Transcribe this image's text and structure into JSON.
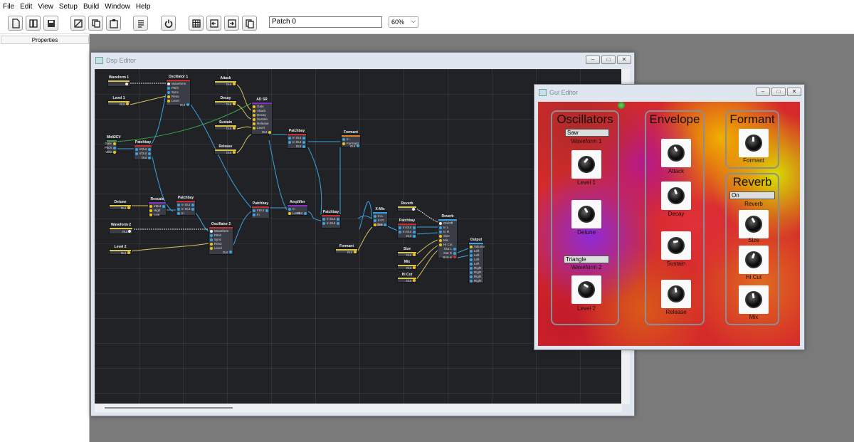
{
  "menu": [
    "File",
    "Edit",
    "View",
    "Setup",
    "Build",
    "Window",
    "Help"
  ],
  "toolbar": {
    "patch_name": "Patch 0",
    "zoom": "60%"
  },
  "properties_title": "Properties",
  "dsp_editor": {
    "title": "Dsp Editor",
    "nodes": {
      "waveform1": "Waveform 1",
      "level1": "Level 1",
      "osc1": "Oscillator 1",
      "midi2cv": "Midi2CV",
      "patchbay1": "Patchbay",
      "attack": "Attack",
      "decay": "Decay",
      "sustain": "Sustain",
      "release": "Release",
      "adsr": "AD SR",
      "patchbay2": "Patchbay",
      "formant1": "Formant",
      "detune": "Detune",
      "rescale": "Rescale",
      "patchbay3": "Patchbay",
      "waveform2": "Waveform 2",
      "level2": "Level 2",
      "osc2": "Oscillator 2",
      "patchbay4": "Patchbay",
      "amplifier": "Amplifier",
      "patchbay5": "Patchbay",
      "xmix": "X-Mix",
      "formant2": "Formant",
      "reverb_ctl": "Reverb",
      "patchbay6": "Patchbay",
      "reverb": "Reverb",
      "output": "Output",
      "size": "Size",
      "mix": "Mix",
      "hicut": "Hi Cut"
    },
    "ports": {
      "out": "Out",
      "in": "In",
      "waveform": "Waveform",
      "pitch": "Pitch",
      "sync": "Sync",
      "reso": "Reso",
      "level": "Level",
      "gate": "Gate",
      "velo": "Velo",
      "attack": "Attack",
      "decay": "Decay",
      "sustain": "Sustain",
      "release": "Release",
      "high": "High",
      "low": "Low",
      "formant": "Formant",
      "in_l": "In L",
      "in_r": "In R",
      "mix": "Mix",
      "onoff": "On/Off",
      "size": "Size",
      "hicut": "Hi Cut",
      "out_l": "Out L",
      "out_r": "Out R",
      "bonus": "Bonus",
      "volume": "Volume",
      "left": "Left",
      "right": "Right"
    }
  },
  "gui_editor": {
    "title": "Gui Editor",
    "oscillators": {
      "title": "Oscillators",
      "wave1_value": "Saw",
      "wave1_label": "Waveform 1",
      "level1": "Level 1",
      "detune": "Detune",
      "wave2_value": "Triangle",
      "wave2_label": "Waveform 2",
      "level2": "Level 2"
    },
    "envelope": {
      "title": "Envelope",
      "attack": "Attack",
      "decay": "Decay",
      "sustain": "Sustain",
      "release": "Release"
    },
    "formant": {
      "title": "Formant",
      "knob": "Formant"
    },
    "reverb": {
      "title": "Reverb",
      "state": "On",
      "state_label": "Reverb",
      "size": "Size",
      "hicut": "Hi Cut",
      "mix": "Mix"
    }
  }
}
